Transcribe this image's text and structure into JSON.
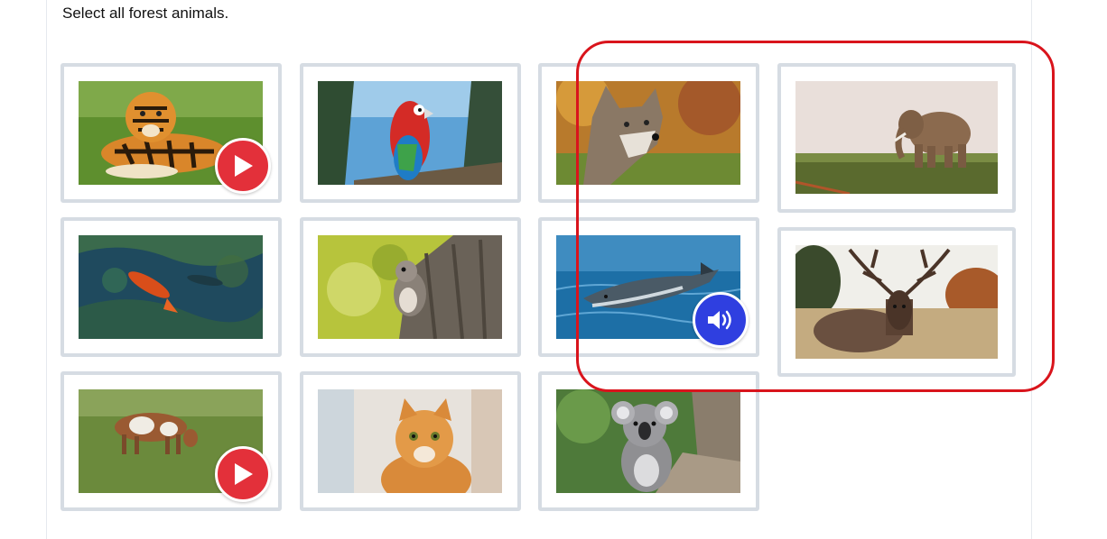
{
  "prompt": "Select all forest animals.",
  "colors": {
    "card_border": "#d6dce3",
    "play_button": "#e3303a",
    "audio_button": "#2f3fe0",
    "highlight": "#d9141c"
  },
  "choices": [
    {
      "animal": "tiger",
      "overlay": "play-icon"
    },
    {
      "animal": "parrot",
      "overlay": null
    },
    {
      "animal": "wolf",
      "overlay": null
    },
    {
      "animal": "elephant",
      "overlay": null
    },
    {
      "animal": "koi fish",
      "overlay": null
    },
    {
      "animal": "squirrel",
      "overlay": null
    },
    {
      "animal": "dolphin",
      "overlay": "speaker-icon"
    },
    {
      "animal": "deer",
      "overlay": null
    },
    {
      "animal": "cow",
      "overlay": "play-icon"
    },
    {
      "animal": "cat",
      "overlay": null
    },
    {
      "animal": "koala",
      "overlay": null
    }
  ]
}
